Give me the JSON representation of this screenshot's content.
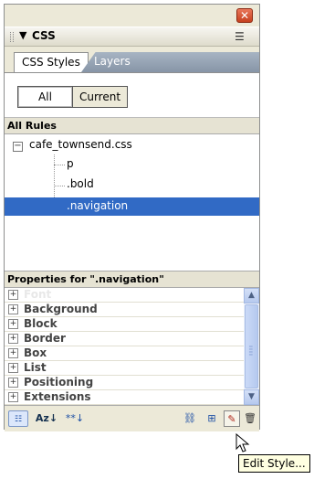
{
  "panel": {
    "title": "CSS",
    "title_arrow": "▼",
    "tabs": [
      {
        "label": "CSS Styles",
        "active": true
      },
      {
        "label": "Layers",
        "active": false
      }
    ],
    "view_toggle": {
      "all_label": "All",
      "current_label": "Current",
      "selected": "All"
    },
    "all_rules_header": "All Rules",
    "rules_tree": {
      "file": "cafe_townsend.css",
      "collapse_symbol": "⊟",
      "rules": [
        "p",
        ".bold",
        ".navigation"
      ],
      "selected": ".navigation"
    },
    "properties_header": "Properties for \".navigation\"",
    "property_categories": [
      {
        "label": "Font",
        "faded": true
      },
      {
        "label": "Background"
      },
      {
        "label": "Block"
      },
      {
        "label": "Border"
      },
      {
        "label": "Box"
      },
      {
        "label": "List"
      },
      {
        "label": "Positioning"
      },
      {
        "label": "Extensions"
      }
    ],
    "plus_symbol": "+",
    "toolbar": {
      "category_view_icon": "category-view-icon",
      "az_label": "Az↓",
      "set_properties_label": "**↓",
      "attach_icon": "attach-style-sheet-icon",
      "new_icon": "new-css-rule-icon",
      "edit_icon": "edit-style-icon",
      "delete_icon": "trash-icon"
    }
  },
  "tooltip": {
    "text": "Edit Style..."
  },
  "colors": {
    "selection": "#316ac5",
    "panel_bg": "#ece9d8",
    "close_button": "#d0502f",
    "tab_inactive": "#97a5b6",
    "tooltip_bg": "#ffffe1"
  }
}
